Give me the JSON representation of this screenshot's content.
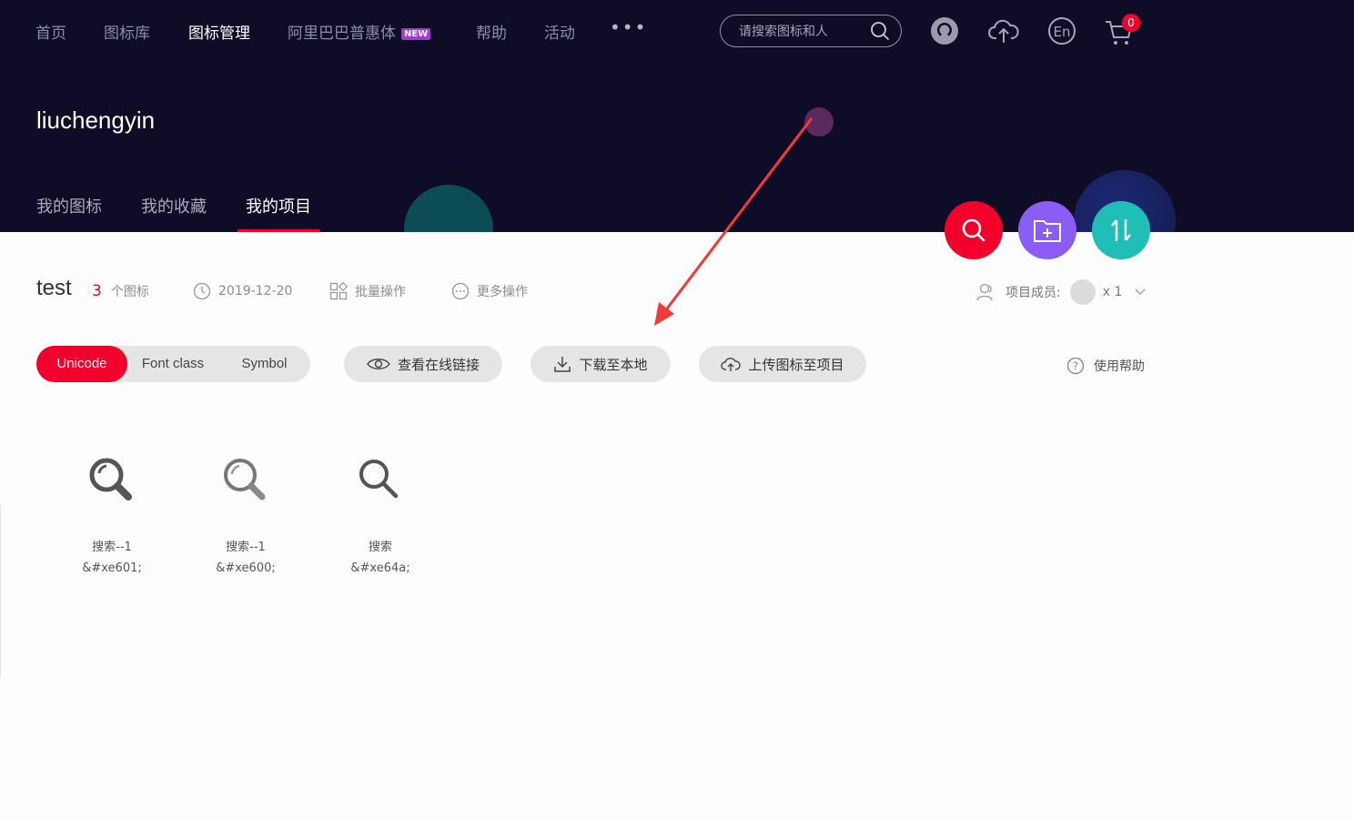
{
  "nav": {
    "items": [
      "首页",
      "图标库",
      "图标管理",
      "阿里巴巴普惠体",
      "帮助",
      "活动"
    ],
    "new_badge": "NEW",
    "more": "•••",
    "search_placeholder": "请搜索图标和人",
    "cart_count": "0",
    "lang_label": "En"
  },
  "profile": {
    "username": "liuchengyin",
    "tabs": [
      "我的图标",
      "我的收藏",
      "我的项目"
    ]
  },
  "project": {
    "name": "test",
    "icon_count": "3",
    "icon_count_label": "个图标",
    "date": "2019-12-20",
    "batch_label": "批量操作",
    "more_label": "更多操作",
    "members_label": "项目成员:",
    "members_count": "x 1"
  },
  "toolbar": {
    "modes": [
      "Unicode",
      "Font class",
      "Symbol"
    ],
    "view_link": "查看在线链接",
    "download": "下载至本地",
    "upload": "上传图标至项目",
    "help": "使用帮助"
  },
  "icons": [
    {
      "name": "搜索--1",
      "code": "&#xe601;",
      "glyph": "search-filled-icon"
    },
    {
      "name": "搜索--1",
      "code": "&#xe600;",
      "glyph": "search-light-icon"
    },
    {
      "name": "搜索",
      "code": "&#xe64a;",
      "glyph": "search-outline-icon"
    }
  ],
  "colors": {
    "header_bg": "#0f0c28",
    "accent_red": "#f2002b",
    "purple": "#8b5cf6",
    "teal": "#1fbfb8"
  }
}
